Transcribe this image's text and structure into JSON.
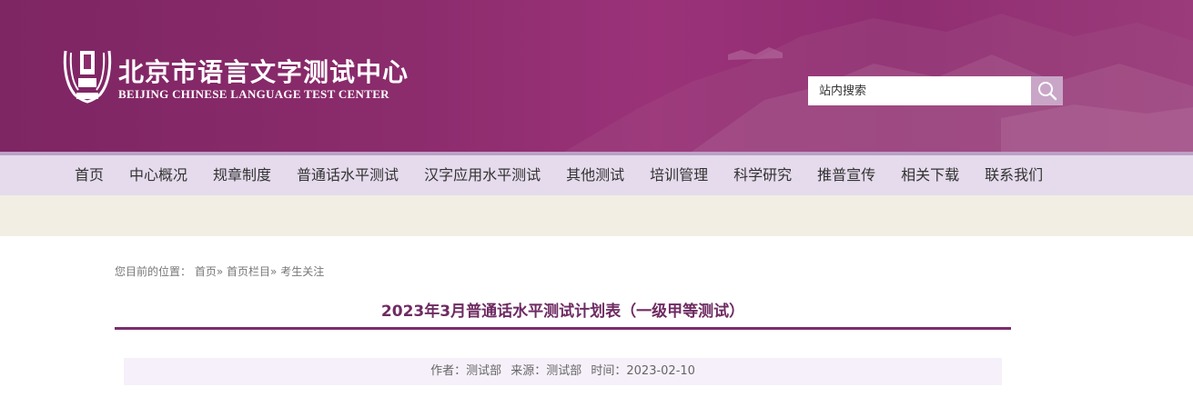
{
  "site": {
    "name_cn": "北京市语言文字测试中心",
    "name_en": "BEIJING CHINESE LANGUAGE TEST CENTER",
    "colors": {
      "header": "#8c2c6d",
      "nav_bg": "#e5dbec",
      "title": "#6e2b62",
      "band": "#f2eee3"
    }
  },
  "search": {
    "placeholder": "站内搜索",
    "icon": "search-icon"
  },
  "nav": {
    "items": [
      "首页",
      "中心概况",
      "规章制度",
      "普通话水平测试",
      "汉字应用水平测试",
      "其他测试",
      "培训管理",
      "科学研究",
      "推普宣传",
      "相关下载",
      "联系我们"
    ]
  },
  "breadcrumb": {
    "prefix": "您目前的位置：",
    "items": [
      "首页",
      "首页栏目",
      "考生关注"
    ],
    "sep": "»"
  },
  "article": {
    "title": "2023年3月普通话水平测试计划表（一级甲等测试）",
    "author": "作者：测试部",
    "source": "来源：测试部",
    "time": "时间：2023-02-10"
  }
}
